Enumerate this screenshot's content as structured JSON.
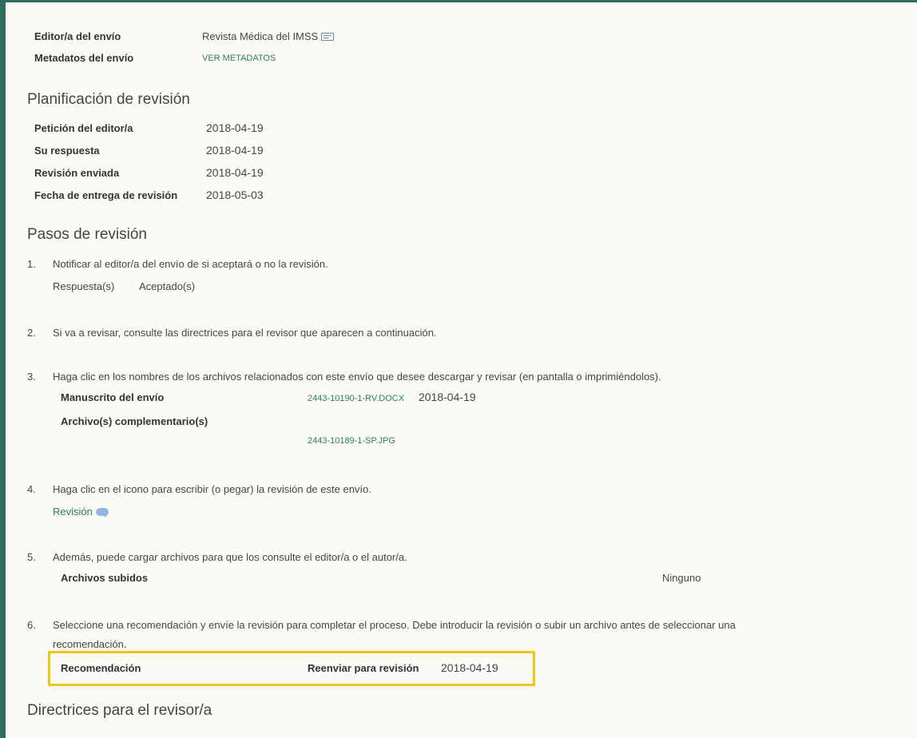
{
  "envio": {
    "editor_label": "Editor/a del envío",
    "editor_value": "Revista Médica del IMSS",
    "metadatos_label": "Metadatos del envío",
    "metadatos_link": "VER METADATOS"
  },
  "planificacion": {
    "title": "Planificación de revisión",
    "rows": [
      {
        "label": "Petición del editor/a",
        "value": "2018-04-19"
      },
      {
        "label": "Su respuesta",
        "value": "2018-04-19"
      },
      {
        "label": "Revisión enviada",
        "value": "2018-04-19"
      },
      {
        "label": "Fecha de entrega de revisión",
        "value": "2018-05-03"
      }
    ]
  },
  "pasos": {
    "title": "Pasos de revisión",
    "step1": {
      "num": "1.",
      "text": "Notificar al editor/a del envío de si aceptará o no la revisión.",
      "resp_label": "Respuesta(s)",
      "resp_value": "Aceptado(s)"
    },
    "step2": {
      "num": "2.",
      "text": "Si va a revisar, consulte las directrices para el revisor que aparecen a continuación."
    },
    "step3": {
      "num": "3.",
      "text": "Haga clic en los nombres de los archivos relacionados con este envío que desee descargar y revisar (en pantalla o imprimiéndolos).",
      "manuscrito_label": "Manuscrito del envío",
      "manuscrito_file": "2443-10190-1-RV.DOCX",
      "manuscrito_date": "2018-04-19",
      "complementario_label": "Archivo(s) complementario(s)",
      "complementario_file": "2443-10189-1-SP.JPG"
    },
    "step4": {
      "num": "4.",
      "text": "Haga clic en el icono para escribir (o pegar) la revisión de este envío.",
      "link": "Revisión"
    },
    "step5": {
      "num": "5.",
      "text": "Además, puede cargar archivos para que los consulte el editor/a o el autor/a.",
      "subidos_label": "Archivos subidos",
      "subidos_value": "Ninguno"
    },
    "step6": {
      "num": "6.",
      "text_line1": "Seleccione una recomendación y envíe la revisión para completar el proceso. Debe introducir la revisión o subir un archivo antes de seleccionar una",
      "text_line2": "recomendación.",
      "recomendacion_label": "Recomendación",
      "recomendacion_value": "Reenviar para revisión",
      "recomendacion_date": "2018-04-19"
    }
  },
  "directrices": {
    "title": "Directrices para el revisor/a"
  },
  "colors": {
    "accent": "#2e6b60",
    "link": "#2c7c5a",
    "highlight": "#f0c419",
    "background": "#fbfbf6"
  }
}
